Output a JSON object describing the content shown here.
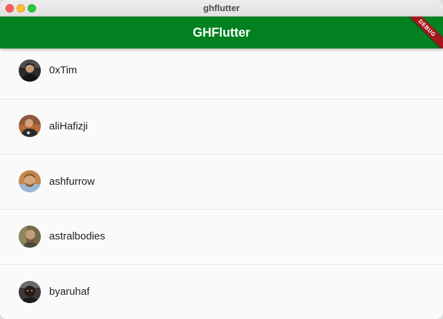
{
  "window": {
    "title": "ghflutter"
  },
  "appbar": {
    "title": "GHFlutter",
    "color": "#018120",
    "debug_banner": "DEBUG"
  },
  "members": [
    {
      "login": "0xTim",
      "avatar": "avatar-icon"
    },
    {
      "login": "aliHafizji",
      "avatar": "avatar-icon"
    },
    {
      "login": "ashfurrow",
      "avatar": "avatar-icon"
    },
    {
      "login": "astralbodies",
      "avatar": "avatar-icon"
    },
    {
      "login": "byaruhaf",
      "avatar": "avatar-icon"
    }
  ]
}
